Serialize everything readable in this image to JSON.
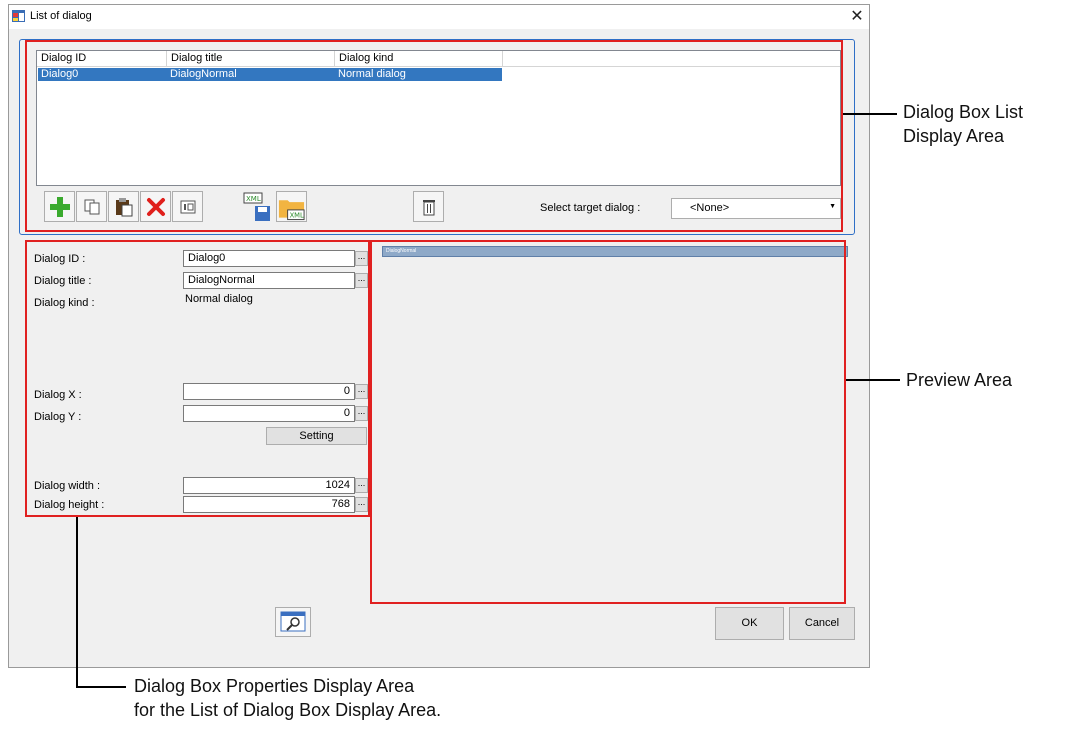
{
  "window": {
    "title": "List of dialog",
    "close_glyph": "✕"
  },
  "list": {
    "columns": [
      "Dialog ID",
      "Dialog title",
      "Dialog kind"
    ],
    "rows": [
      {
        "id": "Dialog0",
        "title": "DialogNormal",
        "kind": "Normal dialog",
        "selected": true
      }
    ]
  },
  "toolbar": {
    "buttons": [
      "add-icon",
      "copy-icon",
      "paste-icon",
      "delete-icon",
      "properties-icon",
      "xml-save-icon",
      "xml-load-icon",
      "trash-icon"
    ],
    "select_label": "Select target dialog :",
    "select_value": "<None>"
  },
  "properties": {
    "id_label": "Dialog ID :",
    "id_value": "Dialog0",
    "title_label": "Dialog title :",
    "title_value": "DialogNormal",
    "kind_label": "Dialog kind :",
    "kind_value": "Normal dialog",
    "x_label": "Dialog X :",
    "x_value": "0",
    "y_label": "Dialog Y :",
    "y_value": "0",
    "setting_label": "Setting",
    "width_label": "Dialog width :",
    "width_value": "1024",
    "height_label": "Dialog height :",
    "height_value": "768",
    "ellipsis": "..."
  },
  "preview": {
    "dialog_title": "DialogNormal"
  },
  "footer": {
    "ok_label": "OK",
    "cancel_label": "Cancel"
  },
  "annotations": {
    "list_area_line1": "Dialog Box List",
    "list_area_line2": "Display Area",
    "preview_area": "Preview Area",
    "props_area_line1": "Dialog Box Properties Display Area",
    "props_area_line2": "for the List of Dialog Box Display Area."
  },
  "colors": {
    "selection": "#3377c0",
    "annotation": "#e02020",
    "group_border": "#2f6fc6"
  }
}
